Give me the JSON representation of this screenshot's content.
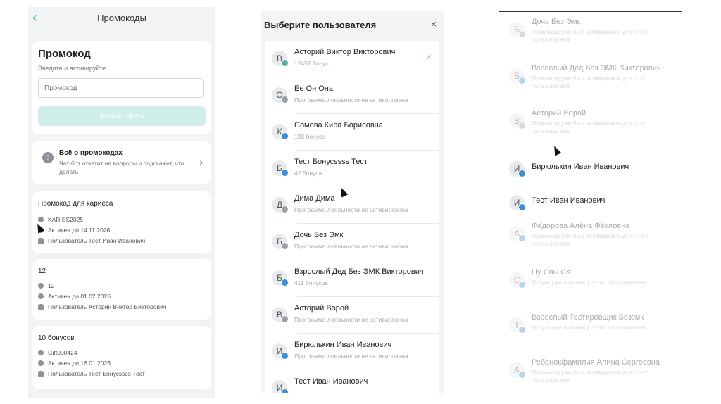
{
  "promo_screen": {
    "title": "Промокоды",
    "form": {
      "heading": "Промокод",
      "subtitle": "Введите и активируйте",
      "placeholder": "Промокод",
      "button": "Активировать"
    },
    "bot": {
      "title": "Всё о промокодах",
      "subtitle": "Чат-бот ответит на вопросы и подскажет, что делать"
    },
    "promos": [
      {
        "title": "Промокод для кариеса",
        "code": "KARIES2025",
        "valid": "Активен до 14.11.2026",
        "user": "Пользователь Тест Иван Иванович"
      },
      {
        "title": "12",
        "code": "12",
        "valid": "Активен до 01.02.2026",
        "user": "Пользователь Асторий Виктор Викторович"
      },
      {
        "title": "10 бонусов",
        "code": "Gift000424",
        "valid": "Активен до 16.01.2026",
        "user": "Пользователь Тест Бонусssss Тест"
      }
    ]
  },
  "user_picker": {
    "title": "Выберите пользователя",
    "close_icon": "×",
    "check_icon": "✓",
    "users": [
      {
        "initial": "В",
        "name": "Асторий Виктор Викторович",
        "sub": "12451 бонус",
        "dot": "#49b6a8",
        "selected": true
      },
      {
        "initial": "О",
        "name": "Ее Он Она",
        "sub": "Программа лояльности не активирована",
        "dot": "#9aa0a6"
      },
      {
        "initial": "К",
        "name": "Сомова Кира Борисовна",
        "sub": "193 бонуса",
        "dot": "#3b8fe0"
      },
      {
        "initial": "Б",
        "name": "Тест Бонусssss Тест",
        "sub": "42 бонуса",
        "dot": "#3b8fe0"
      },
      {
        "initial": "Д",
        "name": "Дима Дима",
        "sub": "Программа лояльности не активирована",
        "dot": "#9aa0a6"
      },
      {
        "initial": "Б",
        "name": "Дочь Без Эмк",
        "sub": "Программа лояльности не активирована",
        "dot": "#9aa0a6"
      },
      {
        "initial": "Б",
        "name": "Взрослый Дед Без ЭМК Викторович",
        "sub": "411 бонусов",
        "dot": "#3b8fe0"
      },
      {
        "initial": "В",
        "name": "Асторий Ворой",
        "sub": "Программа лояльности не активирована",
        "dot": "#9aa0a6"
      },
      {
        "initial": "И",
        "name": "Бирюлькин Иван Иванович",
        "sub": "Программа лояльности не активирована",
        "dot": "#3b8fe0"
      },
      {
        "initial": "И",
        "name": "Тест Иван Иванович",
        "sub": "",
        "dot": "#3b8fe0"
      }
    ]
  },
  "promo_users": [
    {
      "initial": "Б",
      "name": "Дочь Без Эмк",
      "sub": "Промокод уже был активирован для этого пользователя",
      "faded": true,
      "dot": "#9aa0a6"
    },
    {
      "initial": "Б",
      "name": "Взрослый Дед Без ЭМК Викторович",
      "sub": "Промокод уже был активирован для этого пользователя",
      "faded": true,
      "dot": "#3b8fe0"
    },
    {
      "initial": "В",
      "name": "Асторий Ворой",
      "sub": "Промокод уже был активирован для этого пользователя",
      "faded": true,
      "dot": "#9aa0a6"
    },
    {
      "initial": "И",
      "name": "Бирюлькин Иван Иванович",
      "sub": "",
      "faded": false,
      "dot": "#3b8fe0"
    },
    {
      "initial": "И",
      "name": "Тест Иван Иванович",
      "sub": "",
      "faded": false,
      "dot": "#3b8fe0"
    },
    {
      "initial": "А",
      "name": "Фёдорова Алёна Фёкловна",
      "sub": "Промокод уже был активирован для этого пользователя",
      "faded": true,
      "dot": "#3b8fe0"
    },
    {
      "initial": "С",
      "name": "Цу Свы Ся",
      "sub": "Услуга уже активна у этого пользователя",
      "faded": true,
      "dot": "#3b8fe0"
    },
    {
      "initial": "Т",
      "name": "Взрослый Тестировщик Беззмк",
      "sub": "Услуга уже активна у этого пользователя",
      "faded": true,
      "dot": "#3b8fe0"
    },
    {
      "initial": "А",
      "name": "Ребенокфамилия Алина Сергеевна",
      "sub": "Промокод уже был активирован для этого пользователя",
      "faded": true,
      "dot": "#3b8fe0"
    }
  ]
}
